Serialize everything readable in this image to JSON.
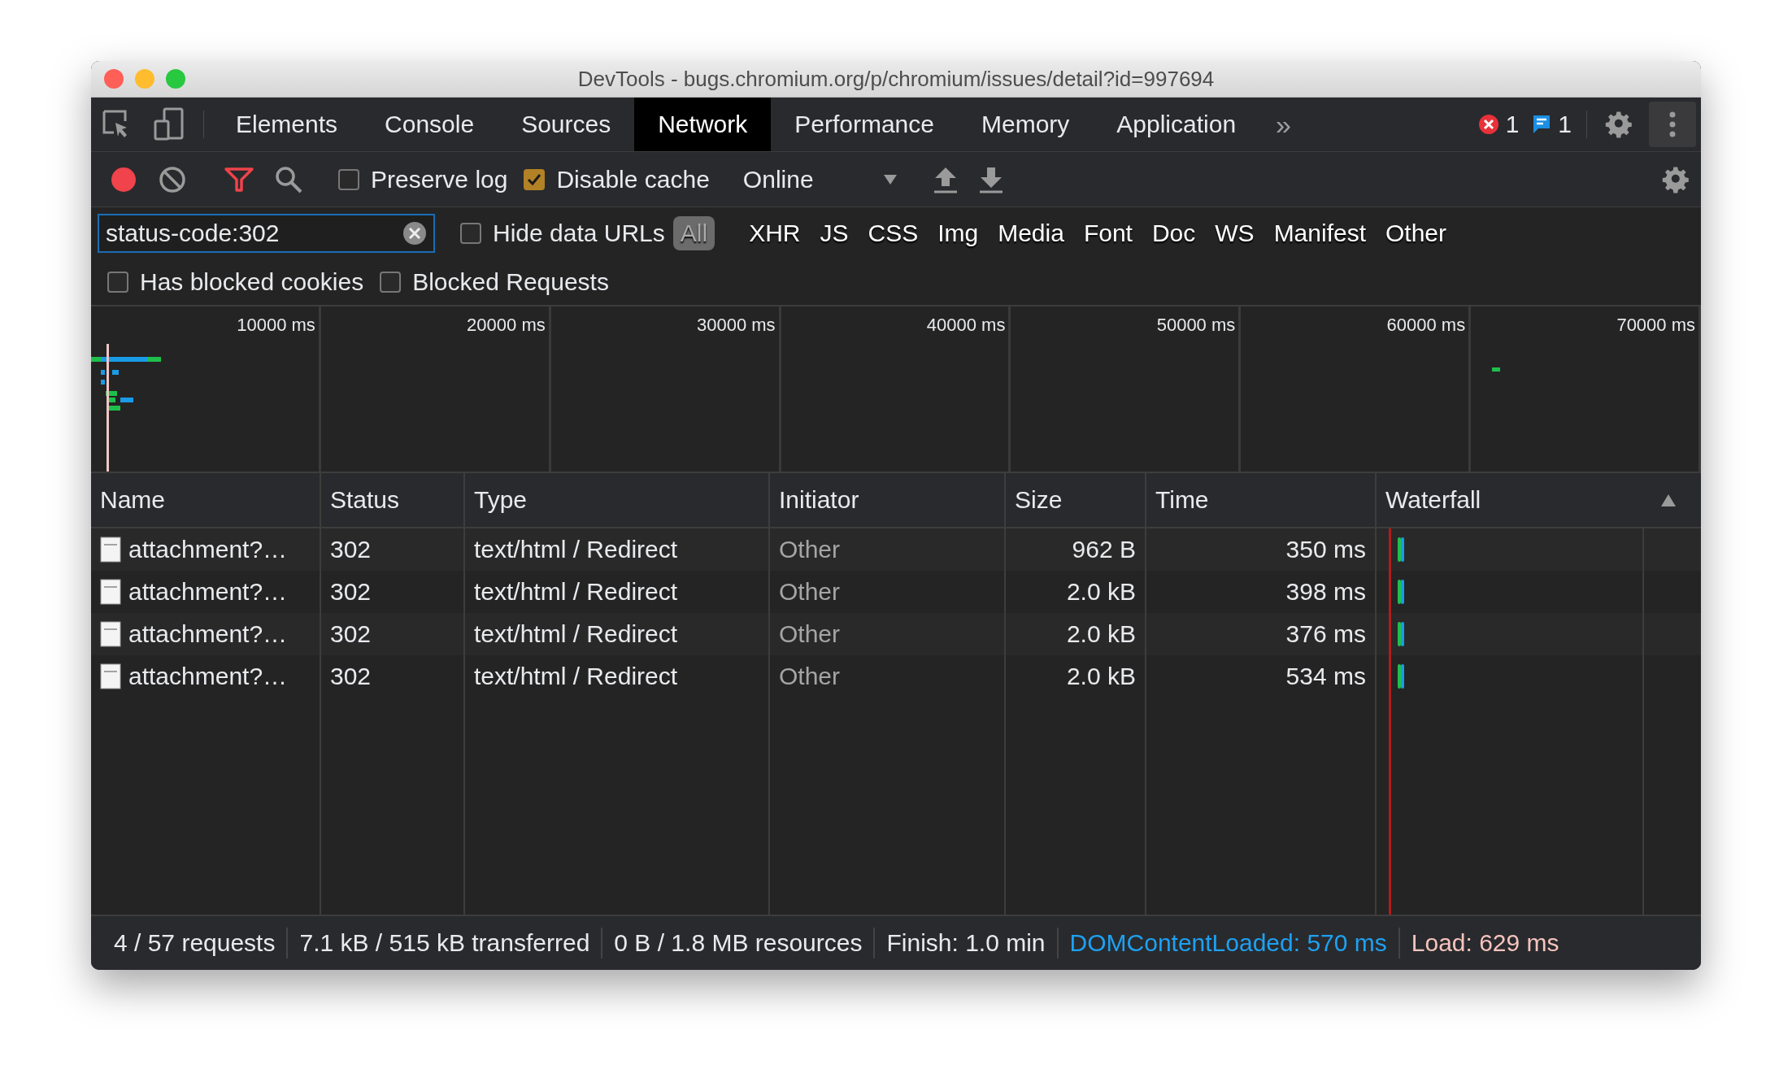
{
  "window": {
    "title": "DevTools - bugs.chromium.org/p/chromium/issues/detail?id=997694"
  },
  "tabs": [
    {
      "label": "Elements",
      "selected": false
    },
    {
      "label": "Console",
      "selected": false
    },
    {
      "label": "Sources",
      "selected": false
    },
    {
      "label": "Network",
      "selected": true
    },
    {
      "label": "Performance",
      "selected": false
    },
    {
      "label": "Memory",
      "selected": false
    },
    {
      "label": "Application",
      "selected": false
    }
  ],
  "more_tabs": "»",
  "counters": {
    "errors": "1",
    "messages": "1"
  },
  "toolbar": {
    "recording": true,
    "filter_on": true,
    "preserve_log": {
      "label": "Preserve log",
      "checked": false
    },
    "disable_cache": {
      "label": "Disable cache",
      "checked": true
    },
    "throttling": "Online"
  },
  "filter": {
    "value": "status-code:302",
    "hide_data_urls": {
      "label": "Hide data URLs",
      "checked": false
    },
    "types": [
      {
        "label": "All",
        "selected": true
      },
      {
        "label": "XHR",
        "selected": false
      },
      {
        "label": "JS",
        "selected": false
      },
      {
        "label": "CSS",
        "selected": false
      },
      {
        "label": "Img",
        "selected": false
      },
      {
        "label": "Media",
        "selected": false
      },
      {
        "label": "Font",
        "selected": false
      },
      {
        "label": "Doc",
        "selected": false
      },
      {
        "label": "WS",
        "selected": false
      },
      {
        "label": "Manifest",
        "selected": false
      },
      {
        "label": "Other",
        "selected": false
      }
    ],
    "has_blocked_cookies": {
      "label": "Has blocked cookies",
      "checked": false
    },
    "blocked_requests": {
      "label": "Blocked Requests",
      "checked": false
    }
  },
  "overview": {
    "ticks": [
      "10000 ms",
      "20000 ms",
      "30000 ms",
      "40000 ms",
      "50000 ms",
      "60000 ms",
      "70000 ms"
    ]
  },
  "table": {
    "columns": [
      {
        "label": "Name",
        "sorted": false
      },
      {
        "label": "Status",
        "sorted": false
      },
      {
        "label": "Type",
        "sorted": false
      },
      {
        "label": "Initiator",
        "sorted": false
      },
      {
        "label": "Size",
        "sorted": false
      },
      {
        "label": "Time",
        "sorted": false
      },
      {
        "label": "Waterfall",
        "sorted": true
      }
    ],
    "rows": [
      {
        "name": "attachment?…",
        "status": "302",
        "type": "text/html / Redirect",
        "initiator": "Other",
        "size": "962 B",
        "time": "350 ms"
      },
      {
        "name": "attachment?…",
        "status": "302",
        "type": "text/html / Redirect",
        "initiator": "Other",
        "size": "2.0 kB",
        "time": "398 ms"
      },
      {
        "name": "attachment?…",
        "status": "302",
        "type": "text/html / Redirect",
        "initiator": "Other",
        "size": "2.0 kB",
        "time": "376 ms"
      },
      {
        "name": "attachment?…",
        "status": "302",
        "type": "text/html / Redirect",
        "initiator": "Other",
        "size": "2.0 kB",
        "time": "534 ms"
      }
    ]
  },
  "status_bar": [
    {
      "kind": "plain",
      "text": "4 / 57 requests"
    },
    {
      "kind": "plain",
      "text": "7.1 kB / 515 kB transferred"
    },
    {
      "kind": "plain",
      "text": "0 B / 1.8 MB resources"
    },
    {
      "kind": "plain",
      "text": "Finish: 1.0 min"
    },
    {
      "kind": "dom",
      "text": "DOMContentLoaded: 570 ms"
    },
    {
      "kind": "load",
      "text": "Load: 629 ms"
    }
  ]
}
